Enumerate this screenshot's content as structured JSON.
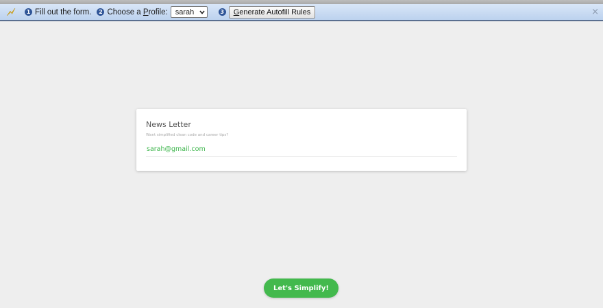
{
  "autofill_bar": {
    "step1_number": "1",
    "step1_text": "Fill out the form.",
    "step2_number": "2",
    "step2_text_prefix": "Choose a ",
    "step2_text_underlined": "P",
    "step2_text_suffix": "rofile:",
    "profile_value": "sarah",
    "step3_number": "3",
    "generate_underlined": "G",
    "generate_rest": "enerate Autofill Rules",
    "close_glyph": "×"
  },
  "card": {
    "title": "News Letter",
    "subtitle": "Want simplified clean code and career tips?",
    "email_value": "sarah@gmail.com"
  },
  "cta": {
    "label": "Let's Simplify!"
  },
  "colors": {
    "accent_green": "#43b94d",
    "email_text": "#3bb54a",
    "step_badge": "#2f5597"
  },
  "icons": {
    "bar_logo": "lightning-bolt-icon",
    "profile_dropdown": "chevron-down-icon",
    "close": "close-icon"
  }
}
